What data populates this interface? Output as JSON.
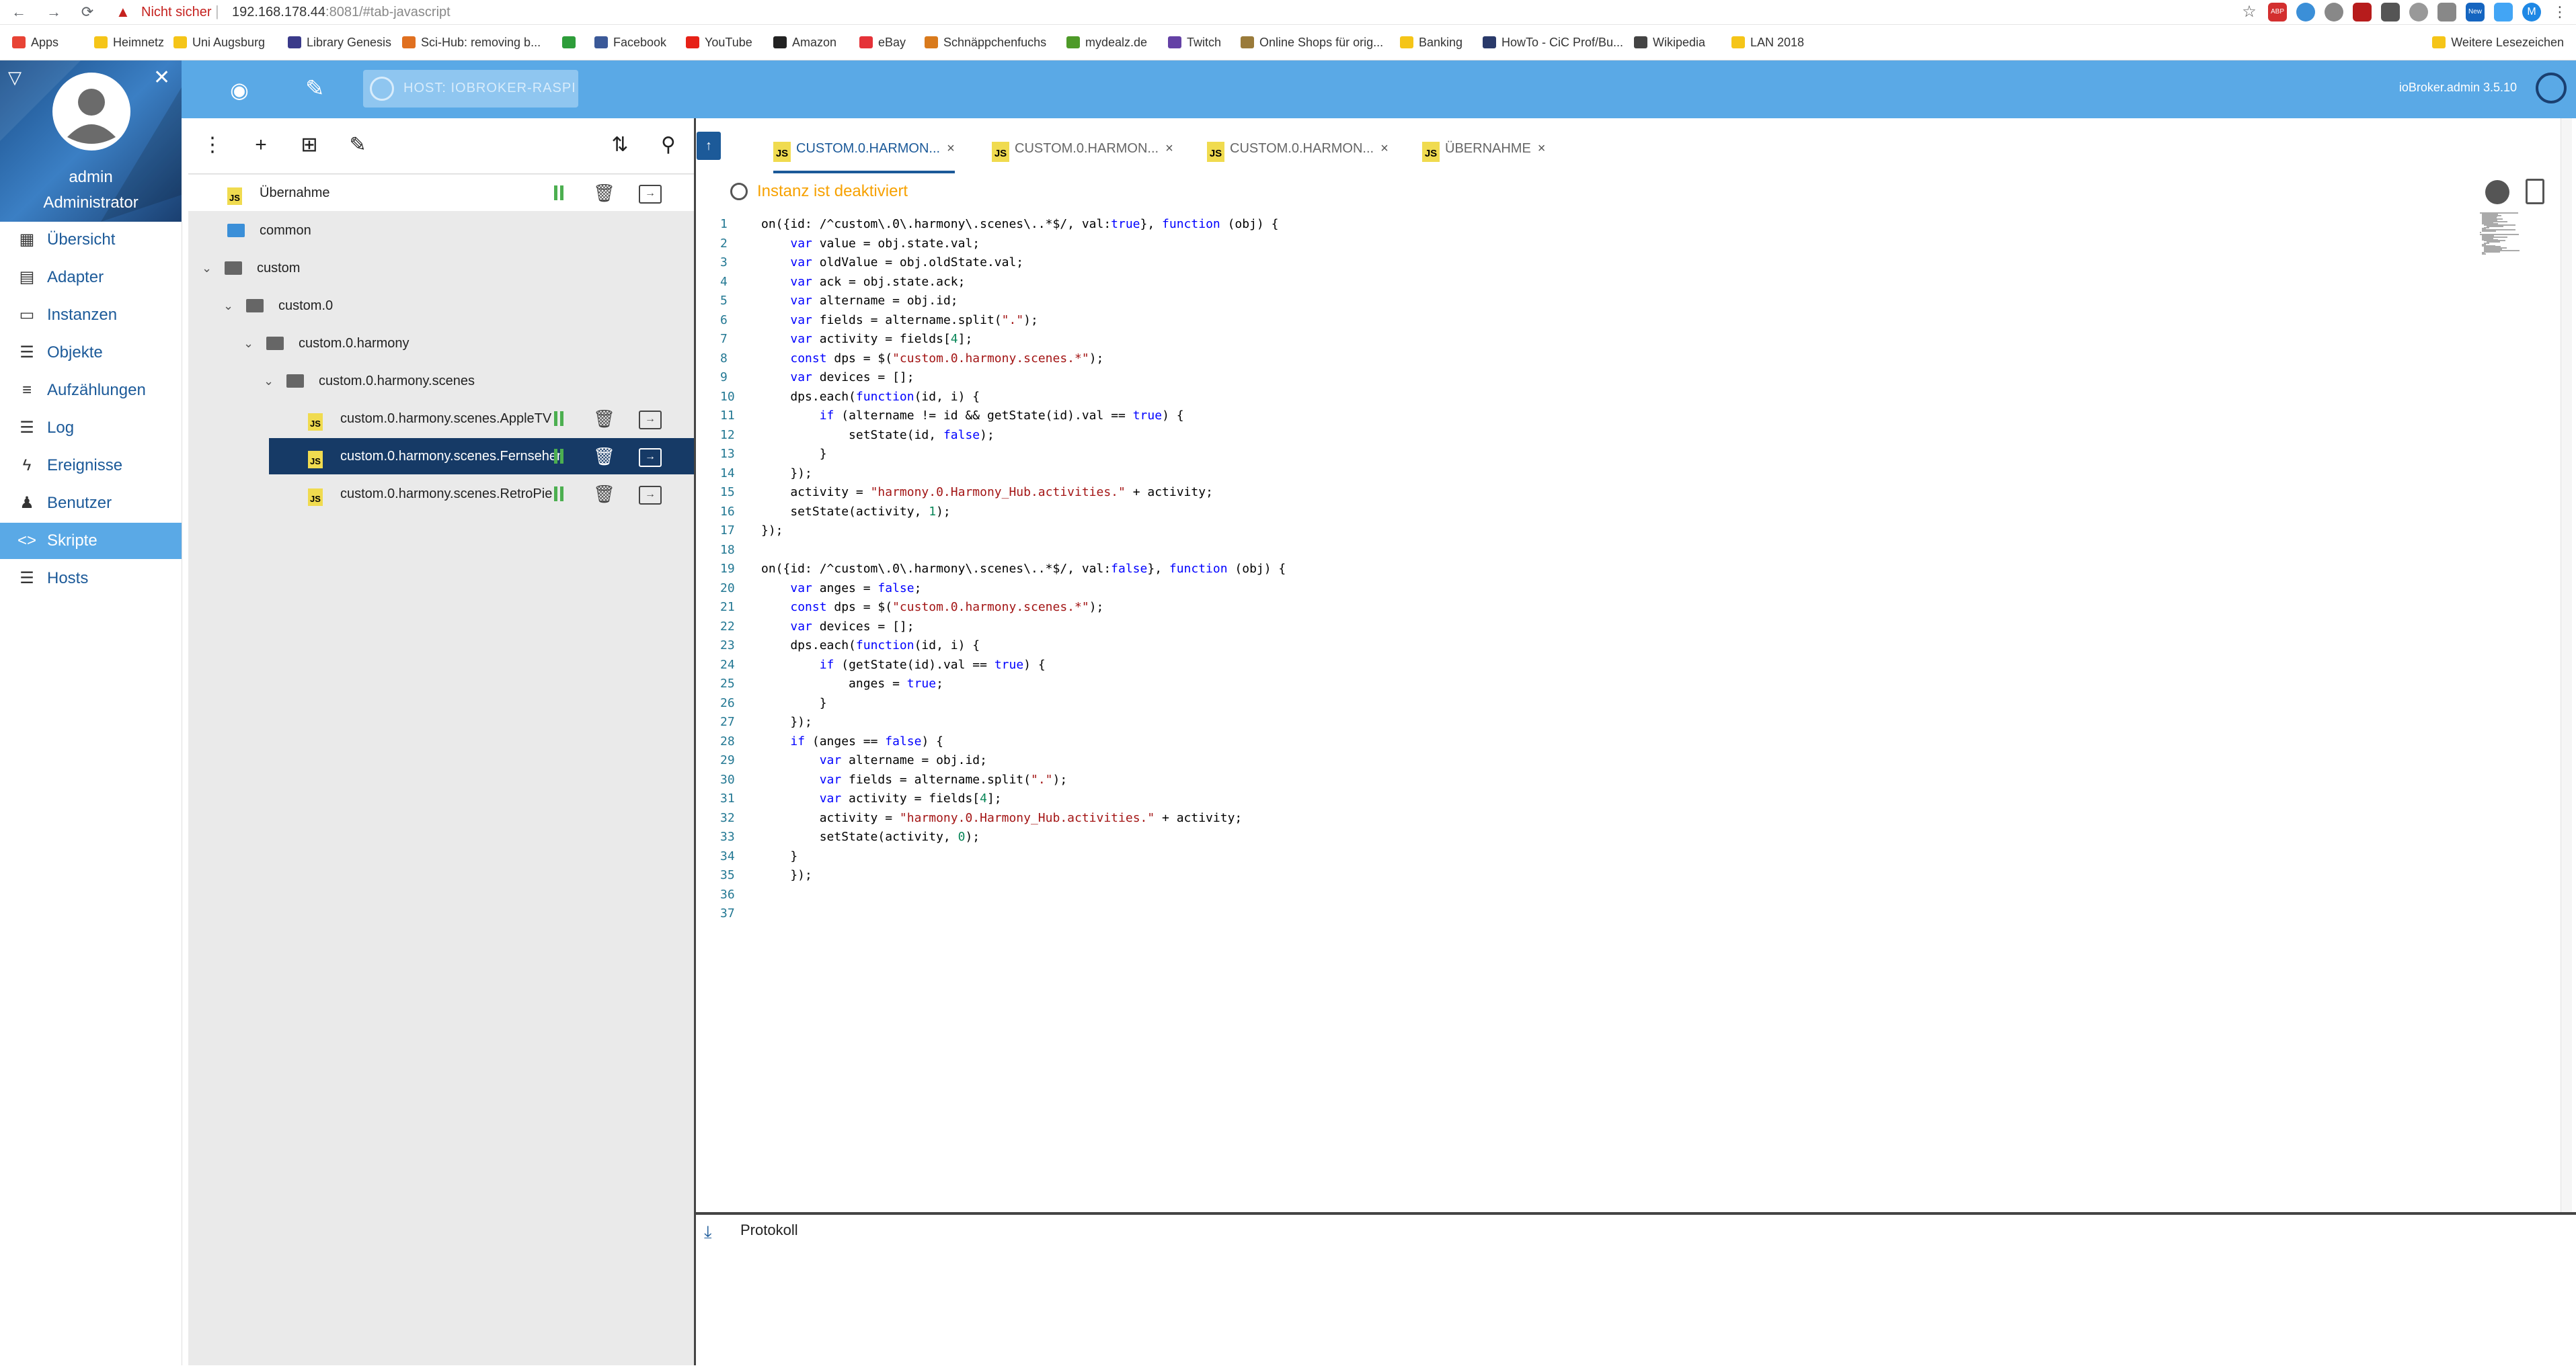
{
  "browser": {
    "nav": {
      "back": "←",
      "forward": "→",
      "reload": "⟳"
    },
    "not_secure": "Nicht sicher",
    "url_host": "192.168.178.44",
    "url_rest": ":8081/#tab-javascript",
    "star": "☆",
    "ext_abp": "ABP",
    "ext_new": "New",
    "profile": "M"
  },
  "bookmarks": [
    {
      "label": "Apps",
      "icon": "apps-grid-icon",
      "color": "#e84335"
    },
    {
      "label": "Heimnetz",
      "icon": "folder-icon",
      "color": "#f5c518"
    },
    {
      "label": "Uni Augsburg",
      "icon": "folder-icon",
      "color": "#f5c518"
    },
    {
      "label": "Library Genesis",
      "icon": "library-icon",
      "color": "#3a3a8a"
    },
    {
      "label": "Sci-Hub: removing b...",
      "icon": "scihub-icon",
      "color": "#e07020"
    },
    {
      "label": "",
      "icon": "green-circle-icon",
      "color": "#2e9d3a"
    },
    {
      "label": "Facebook",
      "icon": "facebook-icon",
      "color": "#3b5998"
    },
    {
      "label": "YouTube",
      "icon": "youtube-icon",
      "color": "#e62117"
    },
    {
      "label": "Amazon",
      "icon": "amazon-icon",
      "color": "#222222"
    },
    {
      "label": "eBay",
      "icon": "ebay-icon",
      "color": "#e53238"
    },
    {
      "label": "Schnäppchenfuchs",
      "icon": "fox-icon",
      "color": "#d97a1c"
    },
    {
      "label": "mydealz.de",
      "icon": "mydealz-icon",
      "color": "#4e9a28"
    },
    {
      "label": "Twitch",
      "icon": "twitch-icon",
      "color": "#6441a5"
    },
    {
      "label": "Online Shops für orig...",
      "icon": "shop-icon",
      "color": "#9a7b3a"
    },
    {
      "label": "Banking",
      "icon": "folder-icon",
      "color": "#f5c518"
    },
    {
      "label": "HowTo - CiC Prof/Bu...",
      "icon": "howto-icon",
      "color": "#2a3a6a"
    },
    {
      "label": "Wikipedia",
      "icon": "wikipedia-icon",
      "color": "#444444"
    },
    {
      "label": "LAN 2018",
      "icon": "folder-icon",
      "color": "#f5c518"
    }
  ],
  "bookmarks_more": "Weitere Lesezeichen",
  "app": {
    "host_button": "HOST: IOBROKER-RASPI",
    "version": "ioBroker.admin 3.5.10",
    "user_name": "admin",
    "user_role": "Administrator"
  },
  "sidebar": [
    {
      "label": "Übersicht",
      "icon": "grid-icon"
    },
    {
      "label": "Adapter",
      "icon": "store-icon"
    },
    {
      "label": "Instanzen",
      "icon": "instances-icon"
    },
    {
      "label": "Objekte",
      "icon": "list-icon"
    },
    {
      "label": "Aufzählungen",
      "icon": "enum-icon"
    },
    {
      "label": "Log",
      "icon": "log-icon"
    },
    {
      "label": "Ereignisse",
      "icon": "flash-icon"
    },
    {
      "label": "Benutzer",
      "icon": "user-icon"
    },
    {
      "label": "Skripte",
      "icon": "code-icon"
    },
    {
      "label": "Hosts",
      "icon": "hosts-icon"
    }
  ],
  "tree": {
    "tools": {
      "menu": "⋮",
      "add": "+",
      "add_folder": "⊞",
      "edit": "✎",
      "sort": "⇅",
      "search": "⚲"
    },
    "items": [
      {
        "label": "Übernahme",
        "type": "script"
      },
      {
        "label": "common",
        "type": "folder"
      },
      {
        "label": "custom",
        "type": "folder"
      },
      {
        "label": "custom.0",
        "type": "folder"
      },
      {
        "label": "custom.0.harmony",
        "type": "folder"
      },
      {
        "label": "custom.0.harmony.scenes",
        "type": "folder"
      },
      {
        "label": "custom.0.harmony.scenes.AppleTV",
        "type": "script"
      },
      {
        "label": "custom.0.harmony.scenes.Fernsehen",
        "type": "script"
      },
      {
        "label": "custom.0.harmony.scenes.RetroPie",
        "type": "script"
      }
    ]
  },
  "tabs": [
    {
      "label": "CUSTOM.0.HARMON...",
      "active": true
    },
    {
      "label": "CUSTOM.0.HARMON...",
      "active": false
    },
    {
      "label": "CUSTOM.0.HARMON...",
      "active": false
    },
    {
      "label": "ÜBERNAHME",
      "active": false
    }
  ],
  "tab_close": "×",
  "js_badge": "JS",
  "instance_status": "Instanz ist deaktiviert",
  "code_lines": [
    "on({id: /^custom\\.0\\.harmony\\.scenes\\..*$/, val:true}, function (obj) {",
    "    var value = obj.state.val;",
    "    var oldValue = obj.oldState.val;",
    "    var ack = obj.state.ack;",
    "    var altername = obj.id;",
    "    var fields = altername.split(\".\");",
    "    var activity = fields[4];",
    "    const dps = $(\"custom.0.harmony.scenes.*\");",
    "    var devices = [];",
    "    dps.each(function(id, i) {",
    "        if (altername != id && getState(id).val == true) {",
    "            setState(id, false);",
    "        }",
    "    });",
    "    activity = \"harmony.0.Harmony_Hub.activities.\" + activity;",
    "    setState(activity, 1);",
    "});",
    "",
    "on({id: /^custom\\.0\\.harmony\\.scenes\\..*$/, val:false}, function (obj) {",
    "    var anges = false;",
    "    const dps = $(\"custom.0.harmony.scenes.*\");",
    "    var devices = [];",
    "    dps.each(function(id, i) {",
    "        if (getState(id).val == true) {",
    "            anges = true;",
    "        }",
    "    });",
    "    if (anges == false) {",
    "        var altername = obj.id;",
    "        var fields = altername.split(\".\");",
    "        var activity = fields[4];",
    "        activity = \"harmony.0.Harmony_Hub.activities.\" + activity;",
    "        setState(activity, 0);",
    "    }",
    "    });",
    "",
    ""
  ],
  "log": {
    "title": "Protokoll",
    "icon": "download-icon"
  }
}
